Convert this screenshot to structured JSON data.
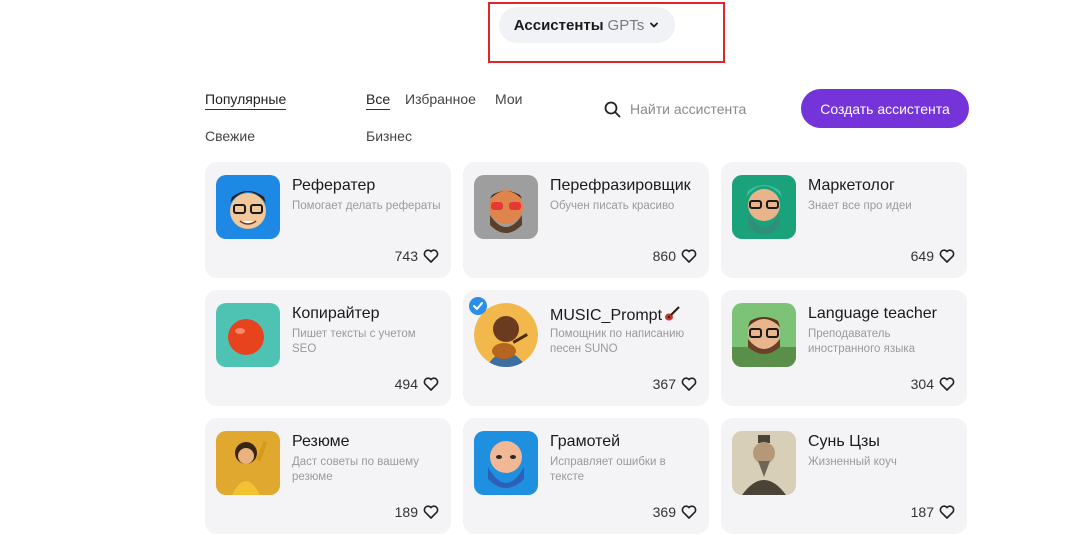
{
  "header": {
    "selector_main": "Ассистенты",
    "selector_sub": "GPTs"
  },
  "filters": {
    "sort_popular": "Популярные",
    "sort_fresh": "Свежие",
    "tab_all": "Все",
    "tab_favorites": "Избранное",
    "tab_mine": "Мои",
    "tab_business": "Бизнес"
  },
  "search": {
    "placeholder": "Найти ассистента"
  },
  "create_button": "Создать ассистента",
  "colors": {
    "accent": "#7434d9",
    "highlight": "#e0262b",
    "card_bg": "#f4f4f6"
  },
  "assistants": [
    {
      "name": "Рефератер",
      "description": "Помогает делать рефераты",
      "likes": "743"
    },
    {
      "name": "Перефразировщик",
      "description": "Обучен писать красиво",
      "likes": "860"
    },
    {
      "name": "Маркетолог",
      "description": "Знает все про идеи",
      "likes": "649"
    },
    {
      "name": "Копирайтер",
      "description": "Пишет тексты с учетом SEO",
      "likes": "494"
    },
    {
      "name": "MUSIC_Prompt",
      "description": "Помощник по написанию песен SUNO",
      "likes": "367"
    },
    {
      "name": "Language teacher",
      "description": "Преподаватель иностранного языка",
      "likes": "304"
    },
    {
      "name": "Резюме",
      "description": "Даст советы по вашему резюме",
      "likes": "189"
    },
    {
      "name": "Грамотей",
      "description": "Исправляет ошибки в тексте",
      "likes": "369"
    },
    {
      "name": "Сунь Цзы",
      "description": "Жизненный коуч",
      "likes": "187"
    }
  ]
}
